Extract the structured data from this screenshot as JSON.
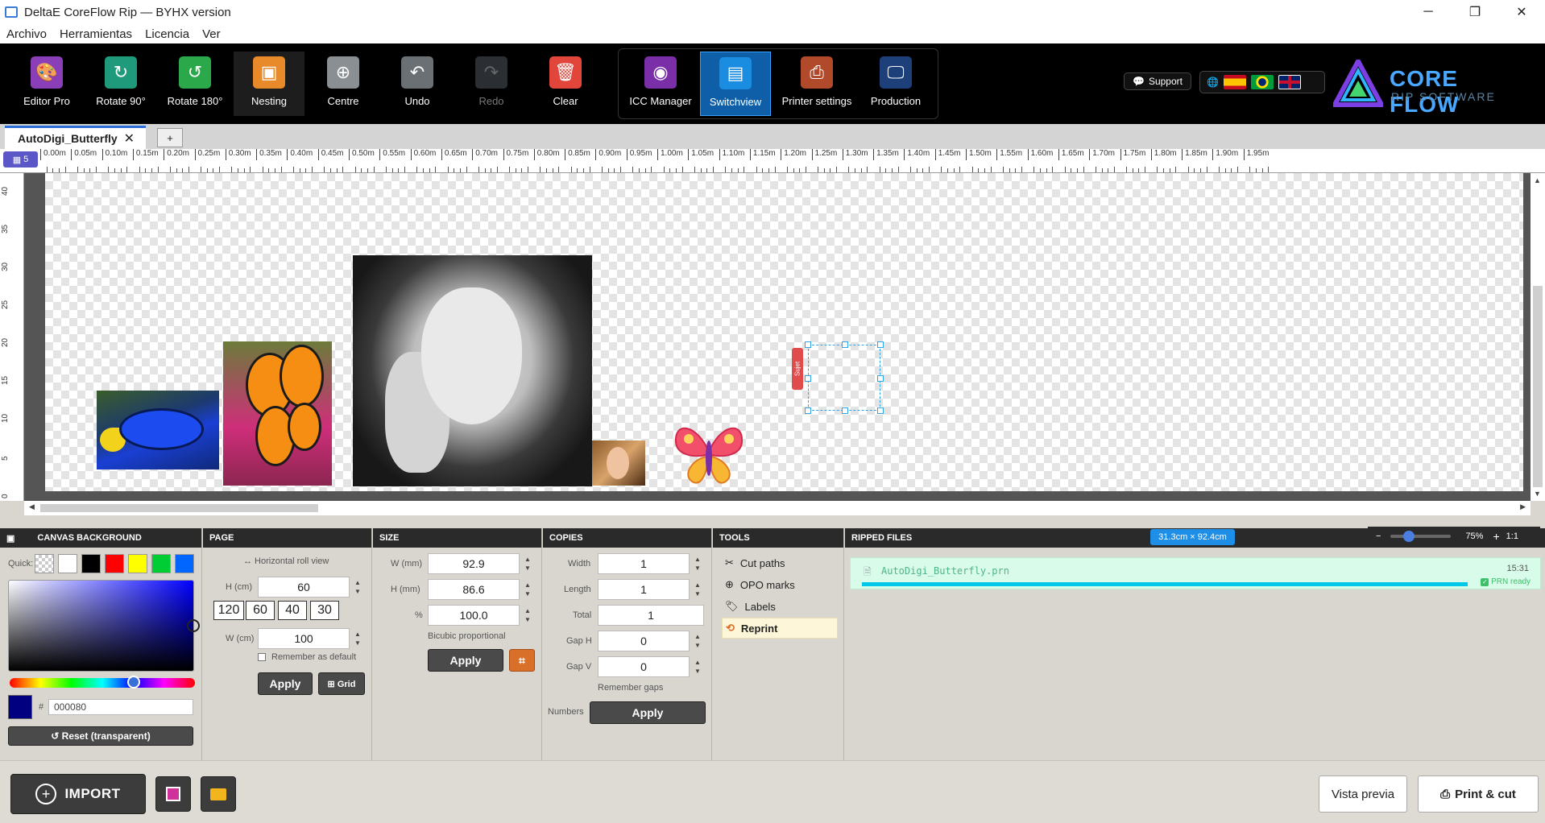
{
  "window": {
    "title": "DeltaE CoreFlow Rip — BYHX version",
    "minimize": "─",
    "restore": "❐",
    "close": "✕"
  },
  "menu": [
    "Archivo",
    "Herramientas",
    "Licencia",
    "Ver"
  ],
  "toolbar": {
    "editor_pro": "Editor Pro",
    "rotate90": "Rotate 90°",
    "rotate180": "Rotate 180°",
    "nesting": "Nesting",
    "centre": "Centre",
    "undo": "Undo",
    "redo": "Redo",
    "clear": "Clear",
    "icc_manager": "ICC Manager",
    "switchview": "Switchview",
    "printer_settings": "Printer settings",
    "production": "Production",
    "support": "Support"
  },
  "logo": {
    "line1": "CORE FLOW",
    "line2": "RIP SOFTWARE"
  },
  "tabs": {
    "active": "AutoDigi_Butterfly",
    "add": "+"
  },
  "ruler": {
    "badge": "5",
    "h_ticks": [
      "0.00m",
      "0.05m",
      "0.10m",
      "0.15m",
      "0.20m",
      "0.25m",
      "0.30m",
      "0.35m",
      "0.40m",
      "0.45m",
      "0.50m",
      "0.55m",
      "0.60m",
      "0.65m",
      "0.70m",
      "0.75m",
      "0.80m",
      "0.85m",
      "0.90m",
      "0.95m",
      "1.00m",
      "1.05m",
      "1.10m",
      "1.15m",
      "1.20m",
      "1.25m",
      "1.30m",
      "1.35m",
      "1.40m",
      "1.45m",
      "1.50m",
      "1.55m",
      "1.60m",
      "1.65m",
      "1.70m",
      "1.75m",
      "1.80m",
      "1.85m",
      "1.90m",
      "1.95m"
    ],
    "v_ticks": [
      "40",
      "35",
      "30",
      "25",
      "20",
      "15",
      "10",
      "5",
      "0"
    ]
  },
  "selection_label": "Sujet",
  "canvas_bg": {
    "header": "CANVAS BACKGROUND",
    "quick_label": "Quick:",
    "swatches": [
      "#ffffff",
      "#000000",
      "#ff0000",
      "#ffff00",
      "#00cc33",
      "#0066ff"
    ],
    "hex_prefix": "#",
    "hex_value": "000080",
    "current_color": "#000080",
    "reset": "↺ Reset (transparent)"
  },
  "page": {
    "header": "PAGE",
    "orientation": "↔ Horizontal roll view",
    "h_label": "H (cm)",
    "h_value": "60",
    "presets": [
      "120",
      "60",
      "40",
      "30"
    ],
    "w_label": "W (cm)",
    "w_value": "100",
    "remember": "Remember as default",
    "apply": "Apply",
    "grid": "⊞ Grid"
  },
  "size": {
    "header": "SIZE",
    "w_label": "W (mm)",
    "w_value": "92.9",
    "h_label": "H (mm)",
    "h_value": "86.6",
    "pct_label": "%",
    "pct_value": "100.0",
    "method": "Bicubic proportional",
    "apply": "Apply"
  },
  "copies": {
    "header": "COPIES",
    "width_label": "Width",
    "width_value": "1",
    "length_label": "Length",
    "length_value": "1",
    "total_label": "Total",
    "total_value": "1",
    "gaph_label": "Gap H",
    "gaph_value": "0",
    "gapv_label": "Gap V",
    "gapv_value": "0",
    "remember": "Remember gaps",
    "numbers_label": "Numbers",
    "apply": "Apply"
  },
  "tools": {
    "header": "TOOLS",
    "items": [
      "Cut paths",
      "OPO marks",
      "Labels",
      "Reprint"
    ]
  },
  "ripped": {
    "header": "RIPPED FILES",
    "dimension": "31.3cm × 92.4cm",
    "file_name": "AutoDigi_Butterfly.prn",
    "time": "15:31",
    "status": "PRN ready",
    "progress": 1.0
  },
  "zoom": {
    "minus": "−",
    "value": "75%",
    "plus": "+",
    "one_to_one": "1:1",
    "level": 0.3
  },
  "footer": {
    "import": "IMPORT",
    "preview": "Vista previa",
    "print_cut": "Print & cut"
  }
}
